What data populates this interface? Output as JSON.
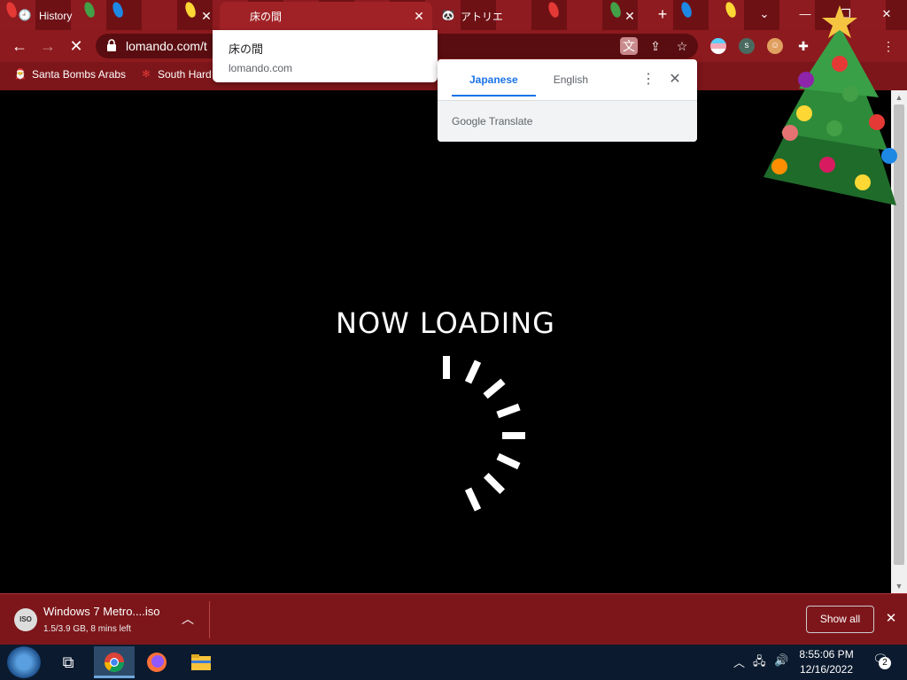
{
  "tabs": [
    {
      "title": "History",
      "favicon": "history-icon",
      "active": false
    },
    {
      "title": "床の間",
      "favicon": "",
      "active": true
    },
    {
      "title": "アトリエ",
      "favicon": "panda-icon",
      "active": false
    }
  ],
  "toolbar": {
    "url": "lomando.com/t"
  },
  "bookmarks": [
    {
      "label": "Santa Bombs Arabs"
    },
    {
      "label": "South Hard"
    }
  ],
  "tooltip": {
    "title": "床の間",
    "url": "lomando.com"
  },
  "translate": {
    "source_lang": "Japanese",
    "target_lang": "English",
    "brand": "Google Translate"
  },
  "page": {
    "loading_text": "NOW LOADING"
  },
  "download": {
    "file_name": "Windows 7 Metro....iso",
    "status": "1.5/3.9 GB, 8 mins left",
    "show_all": "Show all"
  },
  "taskbar": {
    "time": "8:55:06 PM",
    "date": "12/16/2022",
    "notification_count": "2"
  },
  "colors": {
    "accent": "#1a73e8",
    "tabstrip": "#7a1418",
    "toolbar": "#8d1a1e",
    "taskbar": "#0b1a2e"
  }
}
